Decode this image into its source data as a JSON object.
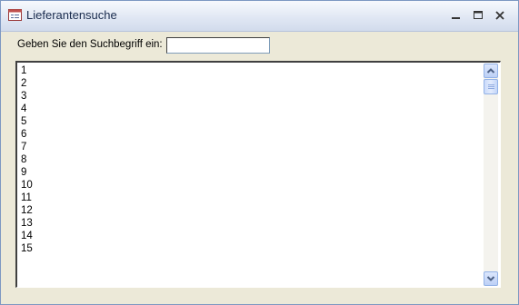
{
  "window": {
    "title": "Lieferantensuche",
    "icon": "form-icon",
    "controls": [
      "minimize-icon",
      "restore-icon",
      "close-icon"
    ]
  },
  "search": {
    "label": "Geben Sie den Suchbegriff ein:",
    "value": "",
    "placeholder": ""
  },
  "list": {
    "items": [
      "1",
      "2",
      "3",
      "4",
      "5",
      "6",
      "7",
      "8",
      "9",
      "10",
      "11",
      "12",
      "13",
      "14",
      "15"
    ]
  },
  "colors": {
    "window_background": "#ece9d8",
    "titlebar": "#dfe6f3",
    "scrollbar_button": "#bcd0f6"
  }
}
